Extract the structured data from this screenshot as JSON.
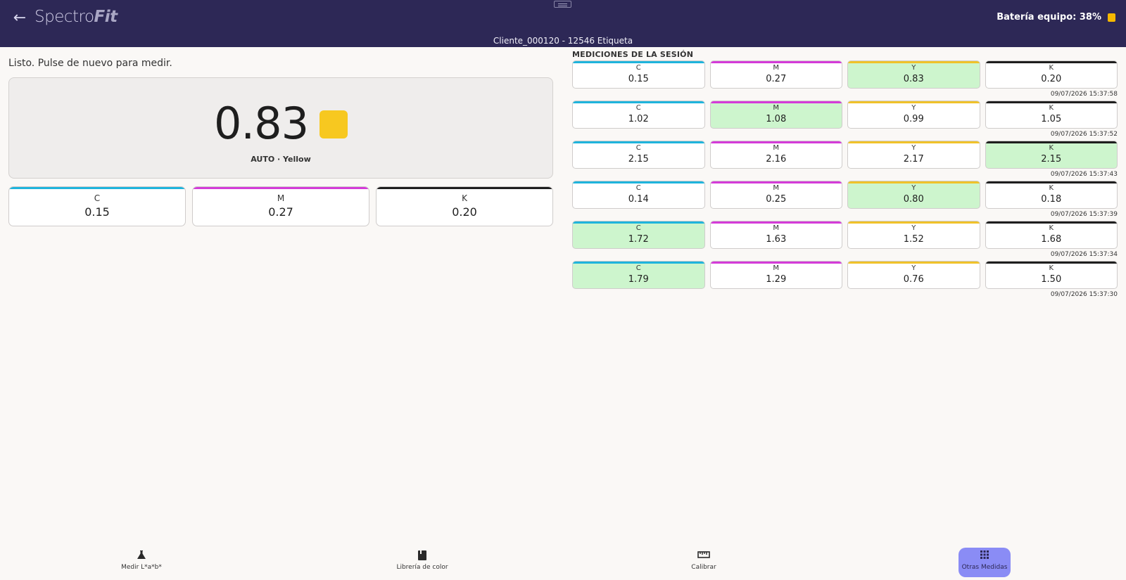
{
  "header": {
    "back_icon": "arrow-left-icon",
    "logo_main": "Spectro",
    "logo_accent": "Fit",
    "battery_label": "Batería equipo: 38%",
    "battery_color": "#f5b800",
    "subtitle": "Cliente_000120 - 12546 Etiqueta"
  },
  "main": {
    "status": "Listo. Pulse de nuevo para medir.",
    "big_value": "0.83",
    "big_swatch_color": "#f7c820",
    "big_caption": "AUTO · Yellow",
    "sub_cards": [
      {
        "label": "C",
        "value": "0.15"
      },
      {
        "label": "M",
        "value": "0.27"
      },
      {
        "label": "K",
        "value": "0.20"
      }
    ]
  },
  "session": {
    "title": "MEDICIONES DE LA SESIÓN",
    "rows": [
      {
        "c": "0.15",
        "m": "0.27",
        "y": "0.83",
        "k": "0.20",
        "highlight": "y",
        "timestamp": "09/07/2026 15:37:58"
      },
      {
        "c": "1.02",
        "m": "1.08",
        "y": "0.99",
        "k": "1.05",
        "highlight": "m",
        "timestamp": "09/07/2026 15:37:52"
      },
      {
        "c": "2.15",
        "m": "2.16",
        "y": "2.17",
        "k": "2.15",
        "highlight": "k",
        "timestamp": "09/07/2026 15:37:43"
      },
      {
        "c": "0.14",
        "m": "0.25",
        "y": "0.80",
        "k": "0.18",
        "highlight": "y",
        "timestamp": "09/07/2026 15:37:39"
      },
      {
        "c": "1.72",
        "m": "1.63",
        "y": "1.52",
        "k": "1.68",
        "highlight": "c",
        "timestamp": "09/07/2026 15:37:34"
      },
      {
        "c": "1.79",
        "m": "1.29",
        "y": "0.76",
        "k": "1.50",
        "highlight": "c",
        "timestamp": "09/07/2026 15:37:30"
      }
    ],
    "labels": {
      "c": "C",
      "m": "M",
      "y": "Y",
      "k": "K"
    }
  },
  "colors": {
    "cyan": "#1fb4dc",
    "magenta": "#d43bd8",
    "yellow": "#f0c22a",
    "black": "#1e1e1e",
    "highlight": "#cdf5cd",
    "header_bg": "#2d2856",
    "active_nav": "#8a8cf5"
  },
  "nav": {
    "items": [
      {
        "label": "Medir L*a*b*",
        "icon": "flask-icon",
        "active": false
      },
      {
        "label": "Librería de color",
        "icon": "book-icon",
        "active": false
      },
      {
        "label": "Calibrar",
        "icon": "ruler-icon",
        "active": false
      },
      {
        "label": "Otras Medidas",
        "icon": "grid-icon",
        "active": true
      }
    ]
  }
}
